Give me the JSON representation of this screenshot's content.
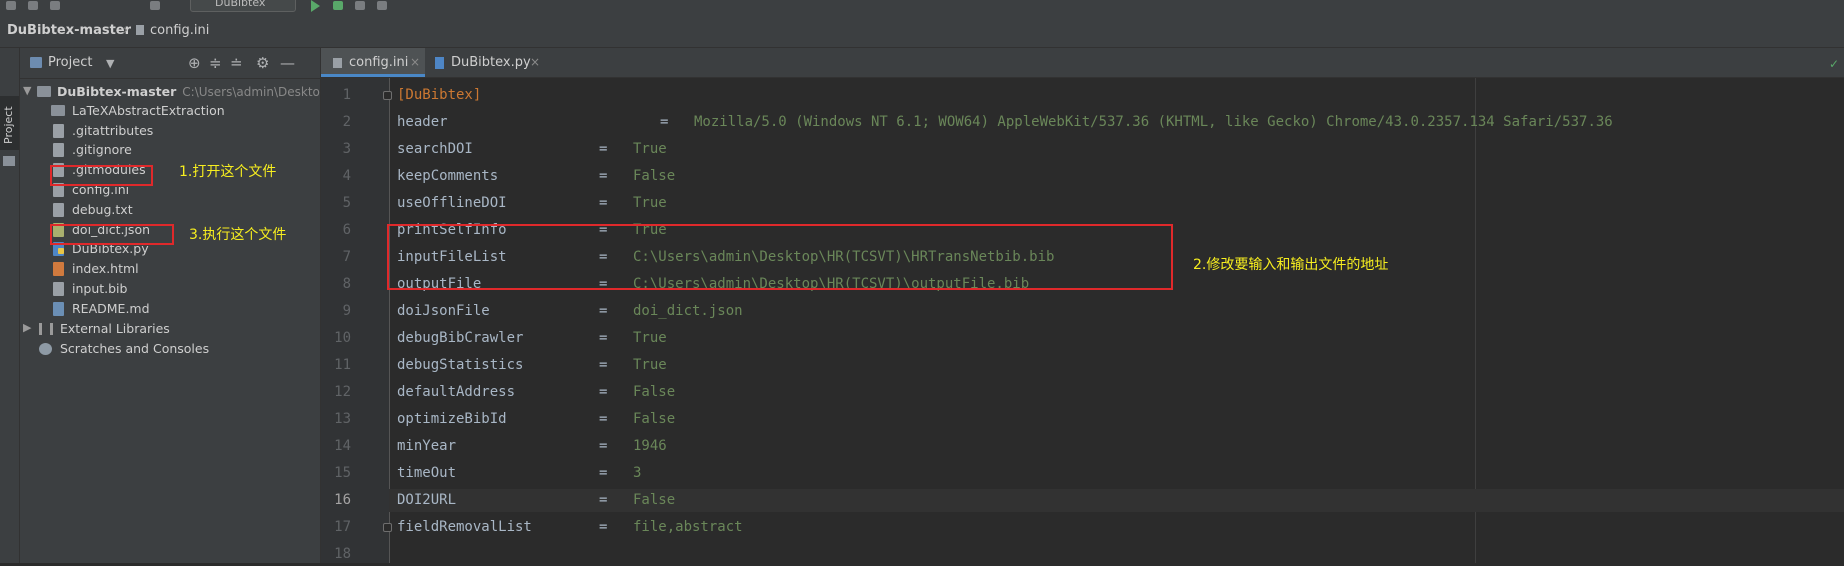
{
  "toolbar": {
    "run_config": "DuBibtex"
  },
  "navbar": {
    "project": "DuBibtex-master",
    "file": "config.ini",
    "separator": "›"
  },
  "side_tab": "Project",
  "project_panel": {
    "title": "Project",
    "tree": [
      {
        "label": "DuBibtex-master",
        "path": "C:\\Users\\admin\\Desktop\\",
        "kind": "root"
      },
      {
        "label": "LaTeXAbstractExtraction",
        "kind": "folder"
      },
      {
        "label": ".gitattributes",
        "kind": "file"
      },
      {
        "label": ".gitignore",
        "kind": "file"
      },
      {
        "label": ".gitmodules",
        "kind": "file"
      },
      {
        "label": "config.ini",
        "kind": "file"
      },
      {
        "label": "debug.txt",
        "kind": "file"
      },
      {
        "label": "doi_dict.json",
        "kind": "json"
      },
      {
        "label": "DuBibtex.py",
        "kind": "py"
      },
      {
        "label": "index.html",
        "kind": "html"
      },
      {
        "label": "input.bib",
        "kind": "file"
      },
      {
        "label": "README.md",
        "kind": "md"
      },
      {
        "label": "External Libraries",
        "kind": "lib"
      },
      {
        "label": "Scratches and Consoles",
        "kind": "scratch"
      }
    ]
  },
  "annotations": {
    "open_file": "1.打开这个文件",
    "execute_file": "3.执行这个文件",
    "modify_paths": "2.修改要输入和输出文件的地址",
    "color": "#f7ee1f",
    "box_color": "#e0292b"
  },
  "editor": {
    "tabs": [
      {
        "label": "config.ini",
        "close": "×",
        "active": true
      },
      {
        "label": "DuBibtex.py",
        "close": "×",
        "active": false
      }
    ],
    "current_line": 16,
    "lines": [
      {
        "n": "1",
        "section": "[DuBibtex]"
      },
      {
        "n": "2",
        "key": "header",
        "eq": "=",
        "val": "Mozilla/5.0 (Windows NT 6.1; WOW64) AppleWebKit/537.36 (KHTML, like Gecko) Chrome/43.0.2357.134 Safari/537.36"
      },
      {
        "n": "3",
        "key": "searchDOI",
        "eq": "=",
        "val": "True"
      },
      {
        "n": "4",
        "key": "keepComments",
        "eq": "=",
        "val": "False"
      },
      {
        "n": "5",
        "key": "useOfflineDOI",
        "eq": "=",
        "val": "True"
      },
      {
        "n": "6",
        "key": "printSelfInfo",
        "eq": "=",
        "val": "True"
      },
      {
        "n": "7",
        "key": "inputFileList",
        "eq": "=",
        "val": "C:\\Users\\admin\\Desktop\\HR(TCSVT)\\HRTransNetbib.bib"
      },
      {
        "n": "8",
        "key": "outputFile",
        "eq": "=",
        "val": "C:\\Users\\admin\\Desktop\\HR(TCSVT)\\outputFile.bib"
      },
      {
        "n": "9",
        "key": "doiJsonFile",
        "eq": "=",
        "val": "doi_dict.json"
      },
      {
        "n": "10",
        "key": "debugBibCrawler",
        "eq": "=",
        "val": "True"
      },
      {
        "n": "11",
        "key": "debugStatistics",
        "eq": "=",
        "val": "True"
      },
      {
        "n": "12",
        "key": "defaultAddress",
        "eq": "=",
        "val": "False"
      },
      {
        "n": "13",
        "key": "optimizeBibId",
        "eq": "=",
        "val": "False"
      },
      {
        "n": "14",
        "key": "minYear",
        "eq": "=",
        "val": "1946"
      },
      {
        "n": "15",
        "key": "timeOut",
        "eq": "=",
        "val": "3"
      },
      {
        "n": "16",
        "key": "DOI2URL",
        "eq": "=",
        "val": "False"
      },
      {
        "n": "17",
        "key": "fieldRemovalList",
        "eq": "=",
        "val": "file,abstract"
      },
      {
        "n": "18"
      }
    ]
  }
}
